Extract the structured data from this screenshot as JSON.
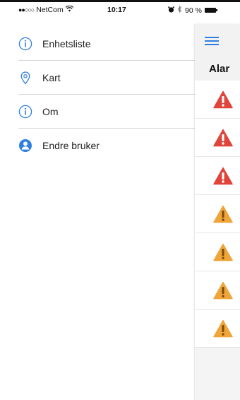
{
  "status_bar": {
    "signal_dots": "●●○○○",
    "carrier": "NetCom",
    "wifi_icon": "wifi-icon",
    "time": "10:17",
    "alarm_icon": "alarm-clock-icon",
    "bluetooth_icon": "bluetooth-icon",
    "battery": "90 %"
  },
  "menu": {
    "items": [
      {
        "label": "Enhetsliste",
        "icon": "info-icon"
      },
      {
        "label": "Kart",
        "icon": "map-pin-icon"
      },
      {
        "label": "Om",
        "icon": "info-icon"
      },
      {
        "label": "Endre bruker",
        "icon": "user-icon"
      }
    ]
  },
  "panel": {
    "menu_icon": "hamburger-icon",
    "title": "Alar",
    "alarms": [
      {
        "severity": "critical"
      },
      {
        "severity": "critical"
      },
      {
        "severity": "critical"
      },
      {
        "severity": "warning"
      },
      {
        "severity": "warning"
      },
      {
        "severity": "warning"
      },
      {
        "severity": "warning"
      }
    ]
  },
  "colors": {
    "accent": "#2f7fe0",
    "critical": "#e0443a",
    "warning": "#f0a53a"
  }
}
